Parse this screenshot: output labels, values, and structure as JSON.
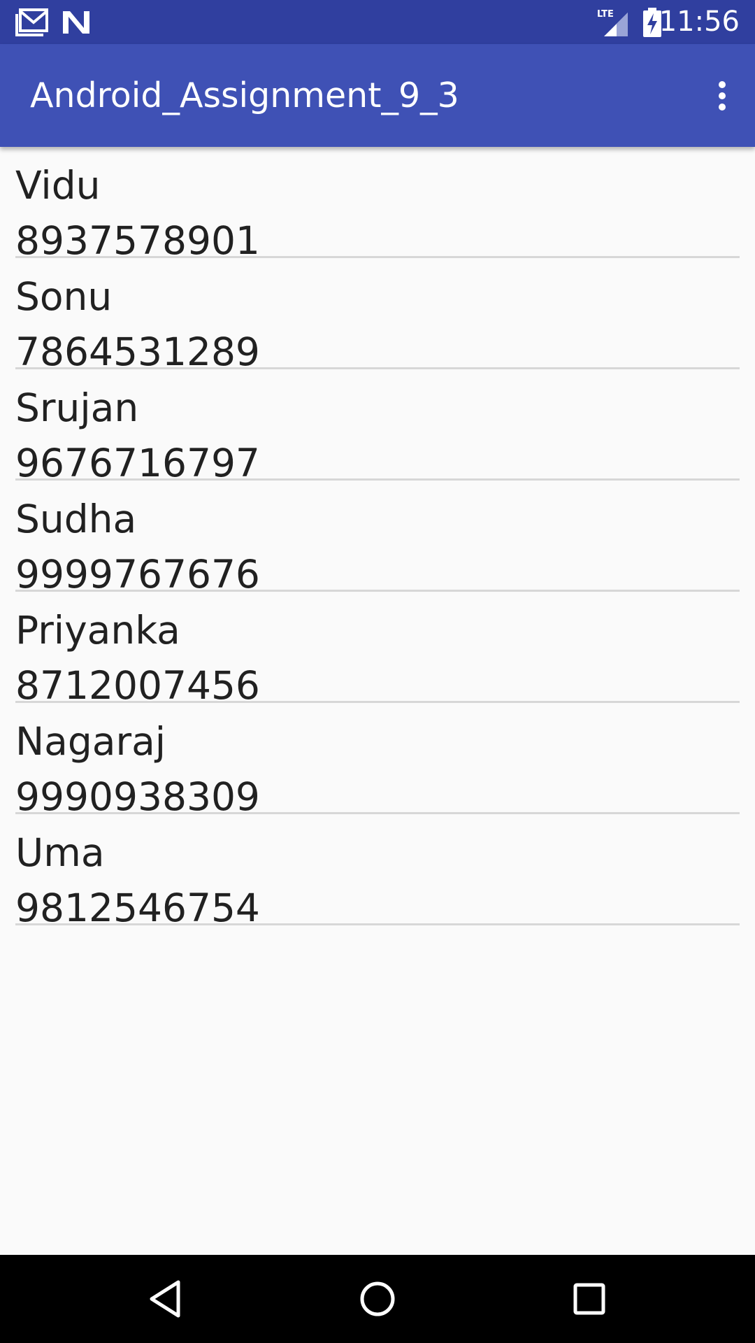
{
  "status_bar": {
    "time": "11:56",
    "network_label": "LTE",
    "icons": [
      "gmail-icon",
      "n-notification-icon",
      "lte-signal-icon",
      "battery-charging-icon"
    ]
  },
  "app_bar": {
    "title": "Android_Assignment_9_3",
    "overflow_icon": "more-vert-icon"
  },
  "contacts": [
    {
      "name": "Vidu",
      "phone": "8937578901"
    },
    {
      "name": "Sonu",
      "phone": "7864531289"
    },
    {
      "name": "Srujan",
      "phone": "9676716797"
    },
    {
      "name": "Sudha",
      "phone": "9999767676"
    },
    {
      "name": "Priyanka",
      "phone": "8712007456"
    },
    {
      "name": "Nagaraj",
      "phone": "9990938309"
    },
    {
      "name": "Uma",
      "phone": "9812546754"
    }
  ],
  "nav_bar": {
    "icons": [
      "back-icon",
      "home-icon",
      "recents-icon"
    ]
  },
  "colors": {
    "status_bar": "#303f9f",
    "app_bar": "#3f51b5",
    "background": "#fafafa",
    "text": "#212121",
    "divider": "#d7d7d7"
  }
}
